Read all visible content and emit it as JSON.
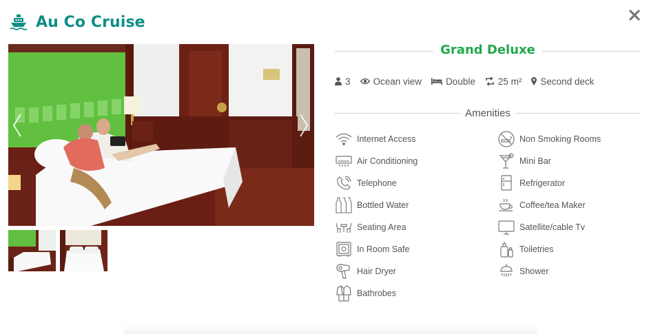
{
  "header": {
    "title": "Au Co Cruise",
    "icon": "ship-icon"
  },
  "close": {
    "icon": "close-icon"
  },
  "gallery": {
    "main_alt": "Couple relaxing on bed in cabin",
    "thumbnails": [
      "thumbnail-1",
      "thumbnail-2"
    ]
  },
  "room": {
    "name": "Grand Deluxe",
    "specs": {
      "guests": "3",
      "view": "Ocean view",
      "bed": "Double",
      "size": "25 m²",
      "deck": "Second deck"
    }
  },
  "amenities": {
    "heading": "Amenities",
    "left": [
      {
        "label": "Internet Access",
        "icon": "wifi-icon"
      },
      {
        "label": "Air Conditioning",
        "icon": "air-conditioner-icon"
      },
      {
        "label": "Telephone",
        "icon": "telephone-icon"
      },
      {
        "label": "Bottled Water",
        "icon": "bottles-icon"
      },
      {
        "label": "Seating Area",
        "icon": "seating-icon"
      },
      {
        "label": "In Room Safe",
        "icon": "safe-icon"
      },
      {
        "label": "Hair Dryer",
        "icon": "hair-dryer-icon"
      },
      {
        "label": "Bathrobes",
        "icon": "bathrobe-icon"
      }
    ],
    "right": [
      {
        "label": "Non Smoking Rooms",
        "icon": "no-smoking-icon"
      },
      {
        "label": "Mini Bar",
        "icon": "cocktail-icon"
      },
      {
        "label": "Refrigerator",
        "icon": "refrigerator-icon"
      },
      {
        "label": "Coffee/tea Maker",
        "icon": "coffee-cup-icon"
      },
      {
        "label": "Satellite/cable Tv",
        "icon": "tv-icon"
      },
      {
        "label": "Toiletries",
        "icon": "toiletries-icon"
      },
      {
        "label": "Shower",
        "icon": "shower-icon"
      }
    ]
  },
  "colors": {
    "brand_teal": "#0e8f86",
    "room_green": "#20a84a",
    "text": "#555555",
    "rule": "#cfcfcf"
  }
}
